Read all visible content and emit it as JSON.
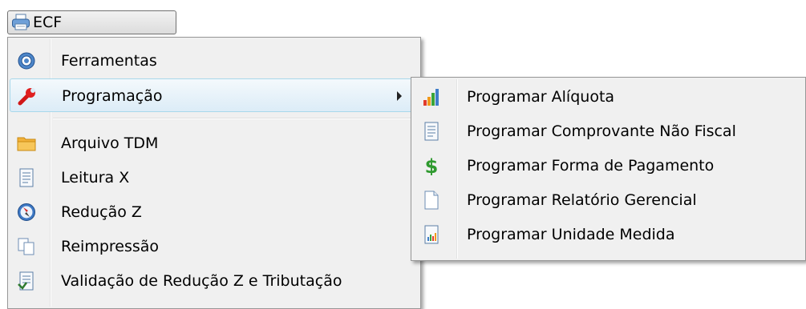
{
  "toolbar": {
    "ecf_label": "ECF",
    "ecf_icon": "printer-icon"
  },
  "main_menu": {
    "items": [
      {
        "label": "Ferramentas",
        "icon": "gear-icon"
      },
      {
        "label": "Programação",
        "icon": "wrench-icon"
      },
      {
        "label": "Arquivo TDM",
        "icon": "folder-icon"
      },
      {
        "label": "Leitura X",
        "icon": "document-icon"
      },
      {
        "label": "Redução Z",
        "icon": "compass-icon"
      },
      {
        "label": "Reimpressão",
        "icon": "copy-icon"
      },
      {
        "label": "Validação de Redução Z e Tributação",
        "icon": "document-check-icon"
      }
    ]
  },
  "sub_menu": {
    "items": [
      {
        "label": "Programar Alíquota",
        "icon": "bar-chart-icon"
      },
      {
        "label": "Programar Comprovante Não Fiscal",
        "icon": "document-icon"
      },
      {
        "label": "Programar Forma de Pagamento",
        "icon": "dollar-icon"
      },
      {
        "label": "Programar Relatório Gerencial",
        "icon": "blank-page-icon"
      },
      {
        "label": "Programar Unidade Medida",
        "icon": "report-icon"
      }
    ]
  }
}
